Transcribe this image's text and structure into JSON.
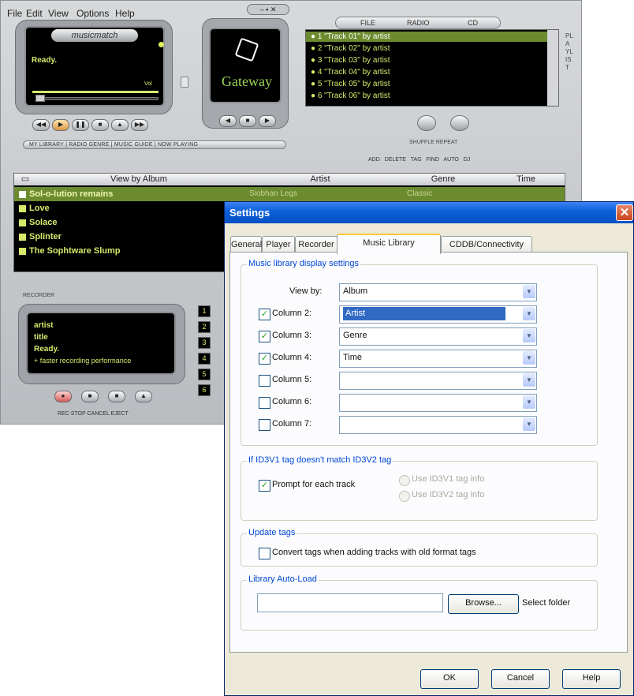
{
  "menu": [
    "File",
    "Edit",
    "View",
    "Options",
    "Help"
  ],
  "player": {
    "logo": "musicmatch",
    "status": "Ready.",
    "vol_label": "Vol",
    "gateway_logo": "Gateway",
    "tabs_row": "MY LIBRARY | RADIO GENRE | MUSIC GUIDE | NOW PLAYING",
    "source_tabs": [
      "FILE",
      "RADIO",
      "CD"
    ],
    "playlist": [
      "1 \"Track 01\" by artist",
      "2 \"Track 02\" by artist",
      "3 \"Track 03\" by artist",
      "4 \"Track 04\" by artist",
      "5 \"Track 05\" by artist",
      "6 \"Track 06\" by artist"
    ],
    "playlist_side": "PLAYLIST",
    "shuffle_repeat": "SHUFFLE REPEAT",
    "lib_toolbar": "ADD DELETE TAG FIND AUTO DJ",
    "columns": [
      "View by Album",
      "Artist",
      "Genre",
      "Time"
    ],
    "albums": [
      "Sol-o-lution remains",
      "Love",
      "Solace",
      "Splinter",
      "The Sophtware Slump"
    ],
    "selected_album_artist": "Siobhan Legs",
    "selected_album_genre": "Classic",
    "recorder_label": "RECORDER",
    "rec_lines": [
      "artist",
      "title",
      "Ready.",
      "+ faster recording performance"
    ],
    "rec_buttons_caption": "REC  STOP  CANCEL  EJECT",
    "track_numbers": [
      "1",
      "2",
      "3",
      "4",
      "5",
      "6"
    ]
  },
  "dialog": {
    "title": "Settings",
    "close": "✕",
    "tabs": [
      "General",
      "Player",
      "Recorder",
      "Music Library",
      "CDDB/Connectivity"
    ],
    "active_tab": "Music Library",
    "group_display": "Music library display settings",
    "view_by_label": "View by:",
    "view_by_value": "Album",
    "columns": [
      {
        "label": "Column 2:",
        "checked": true,
        "value": "Artist"
      },
      {
        "label": "Column 3:",
        "checked": true,
        "value": "Genre"
      },
      {
        "label": "Column 4:",
        "checked": true,
        "value": "Time"
      },
      {
        "label": "Column 5:",
        "checked": false,
        "value": ""
      },
      {
        "label": "Column 6:",
        "checked": false,
        "value": ""
      },
      {
        "label": "Column 7:",
        "checked": false,
        "value": ""
      }
    ],
    "group_id3": "If ID3V1 tag doesn't match ID3V2 tag",
    "prompt_label": "Prompt for each track",
    "radio_v1": "Use ID3V1 tag info",
    "radio_v2": "Use ID3V2 tag info",
    "group_update": "Update tags",
    "convert_label": "Convert tags when adding tracks with old format tags",
    "group_autoload": "Library Auto-Load",
    "autoload_value": "",
    "browse_label": "Browse...",
    "select_folder_label": "Select folder",
    "ok_label": "OK",
    "cancel_label": "Cancel",
    "help_label": "Help",
    "check_glyph": "✓",
    "arrow_glyph": "▼"
  }
}
